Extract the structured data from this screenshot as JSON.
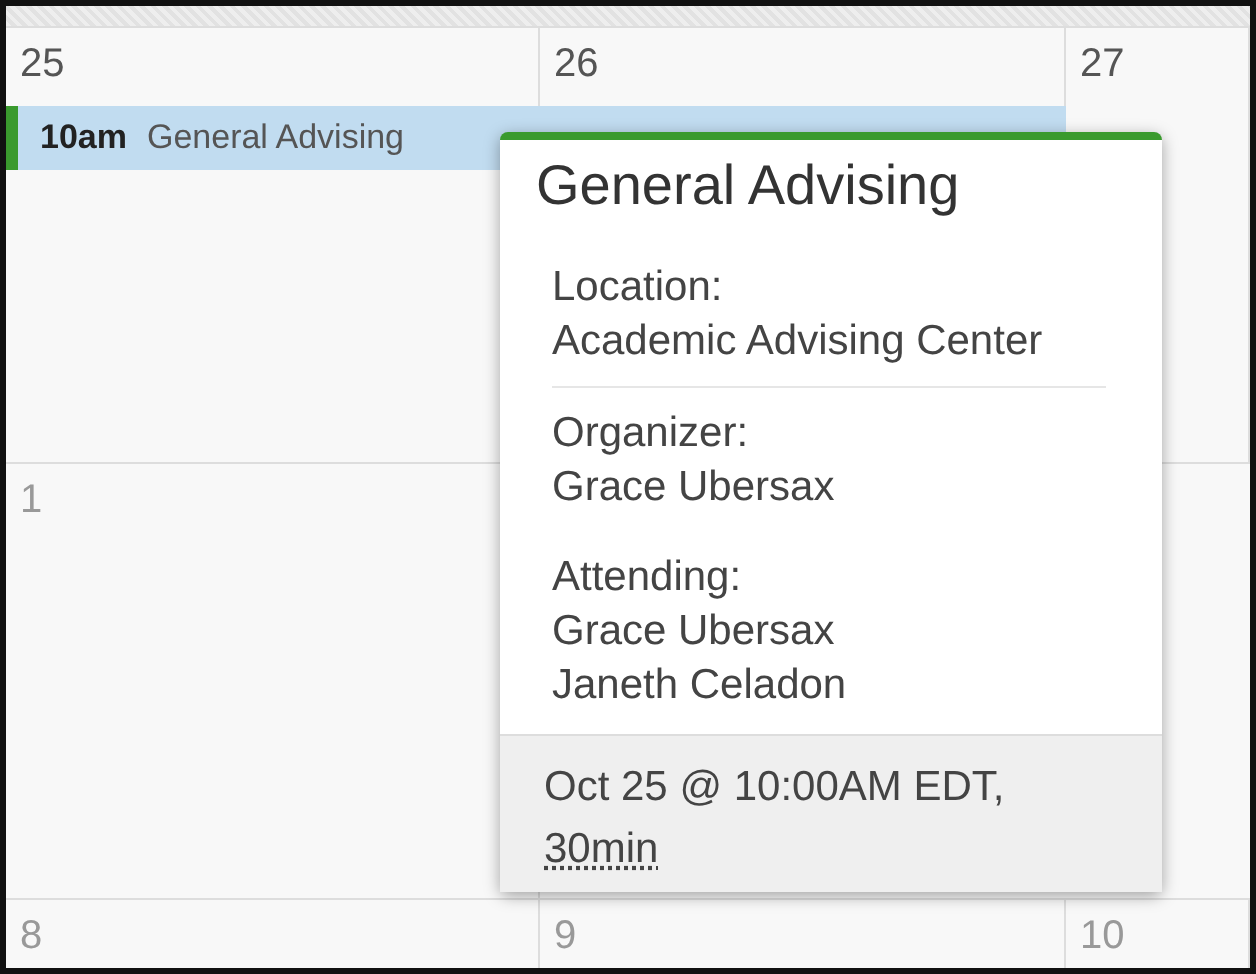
{
  "weeks": [
    {
      "days": [
        {
          "label": "25"
        },
        {
          "label": "26"
        },
        {
          "label": "27"
        }
      ],
      "events": [
        {
          "time": "10am",
          "title": "General Advising",
          "color": "#3a9a2e"
        }
      ]
    },
    {
      "days": [
        {
          "label": "1"
        }
      ]
    },
    {
      "days": [
        {
          "label": "8"
        },
        {
          "label": "9"
        },
        {
          "label": "10"
        }
      ]
    }
  ],
  "popup": {
    "title": "General Advising",
    "sections": [
      {
        "label": "Location:",
        "values": [
          "Academic Advising Center"
        ],
        "divider": true
      },
      {
        "label": "Organizer:",
        "values": [
          "Grace Ubersax"
        ],
        "divider": false
      },
      {
        "label": "Attending:",
        "values": [
          "Grace Ubersax",
          "Janeth Celadon"
        ],
        "divider": false
      }
    ],
    "when": "Oct 25 @ 10:00AM EDT,",
    "duration": "30min",
    "color": "#3a9a2e"
  }
}
